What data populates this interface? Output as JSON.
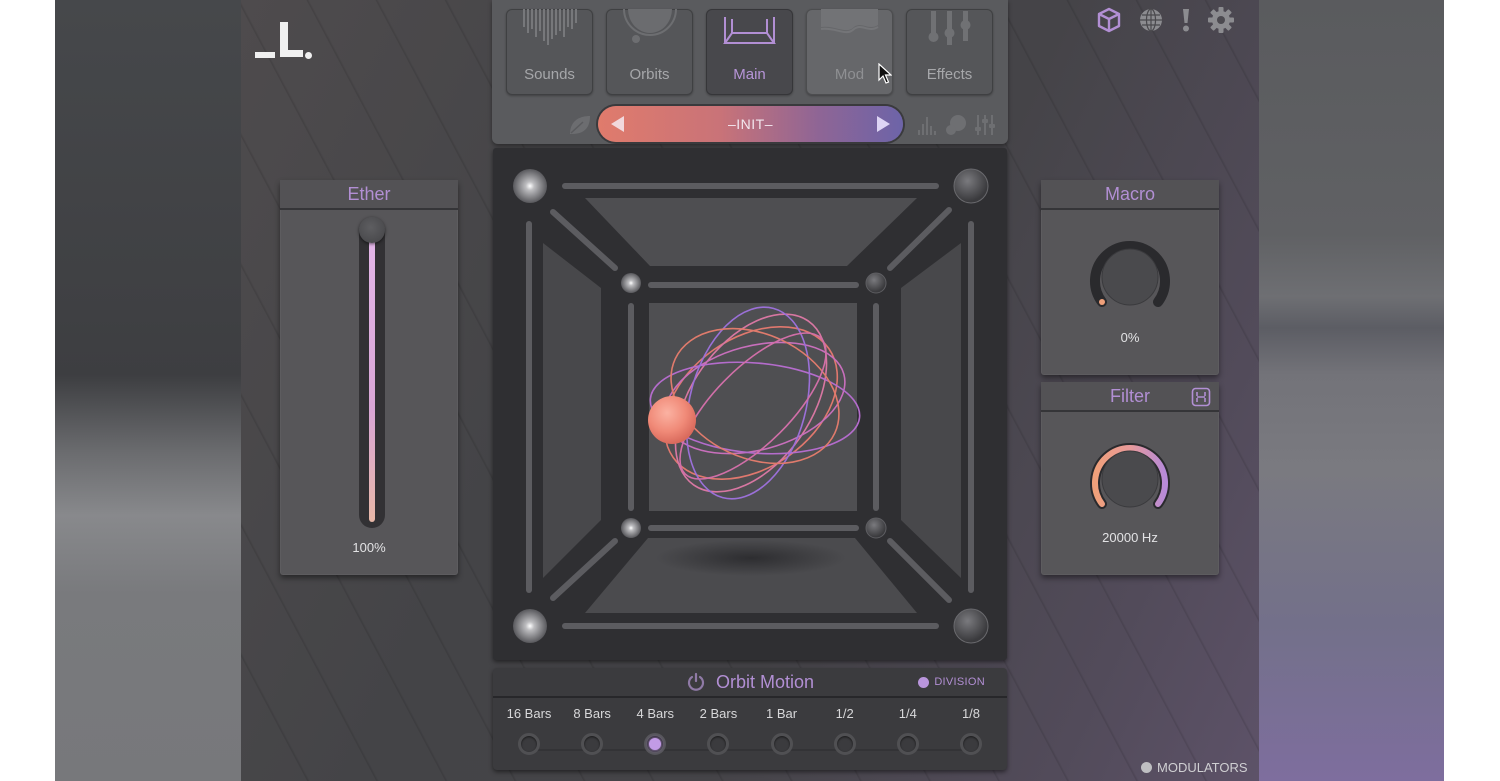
{
  "app": {
    "logo_icon": "brand-logo-icon",
    "top_icons": [
      {
        "name": "cube-icon",
        "color": "#b28fd4",
        "active": true
      },
      {
        "name": "globe-icon",
        "color": "#8c8c90",
        "active": false
      },
      {
        "name": "alert-icon",
        "color": "#8c8c90",
        "active": false
      },
      {
        "name": "gear-icon",
        "color": "#8c8c90",
        "active": false
      }
    ]
  },
  "nav": {
    "tabs": [
      {
        "label": "Sounds",
        "icon": "waveform-icon",
        "state": "normal"
      },
      {
        "label": "Orbits",
        "icon": "orbit-sphere-icon",
        "state": "normal"
      },
      {
        "label": "Main",
        "icon": "cube-room-icon",
        "state": "active"
      },
      {
        "label": "Mod",
        "icon": "modulation-wave-icon",
        "state": "hover"
      },
      {
        "label": "Effects",
        "icon": "faders-icon",
        "state": "normal"
      }
    ],
    "preset": {
      "name": "–INIT–",
      "prev_icon": "triangle-left-icon",
      "next_icon": "triangle-right-icon",
      "left_icon": "leaf-icon",
      "right_icons": [
        "spectrum-icon",
        "blob-icon",
        "mixer-icon"
      ],
      "gradient": [
        "#e07b6c",
        "#6d64a8"
      ]
    }
  },
  "ether": {
    "title": "Ether",
    "value_label": "100%",
    "value_fraction": 1.0
  },
  "macro": {
    "title": "Macro",
    "value_label": "0%",
    "value_fraction": 0.0
  },
  "filter": {
    "title": "Filter",
    "link_icon": "link-chain-icon",
    "value_label": "20000 Hz",
    "value_fraction": 1.0
  },
  "stage": {
    "orb_color": "#f08a78",
    "orbit_colors": [
      "#e0786e",
      "#c36fc4",
      "#9b70d8"
    ]
  },
  "orbit_motion": {
    "title": "Orbit Motion",
    "power_icon": "power-icon",
    "division_label": "DIVISION",
    "divisions": [
      "16 Bars",
      "8 Bars",
      "4 Bars",
      "2 Bars",
      "1 Bar",
      "1/2",
      "1/4",
      "1/8"
    ],
    "selected_index": 2,
    "accent": "#c29be6"
  },
  "footer": {
    "modulators_label": "MODULATORS"
  }
}
